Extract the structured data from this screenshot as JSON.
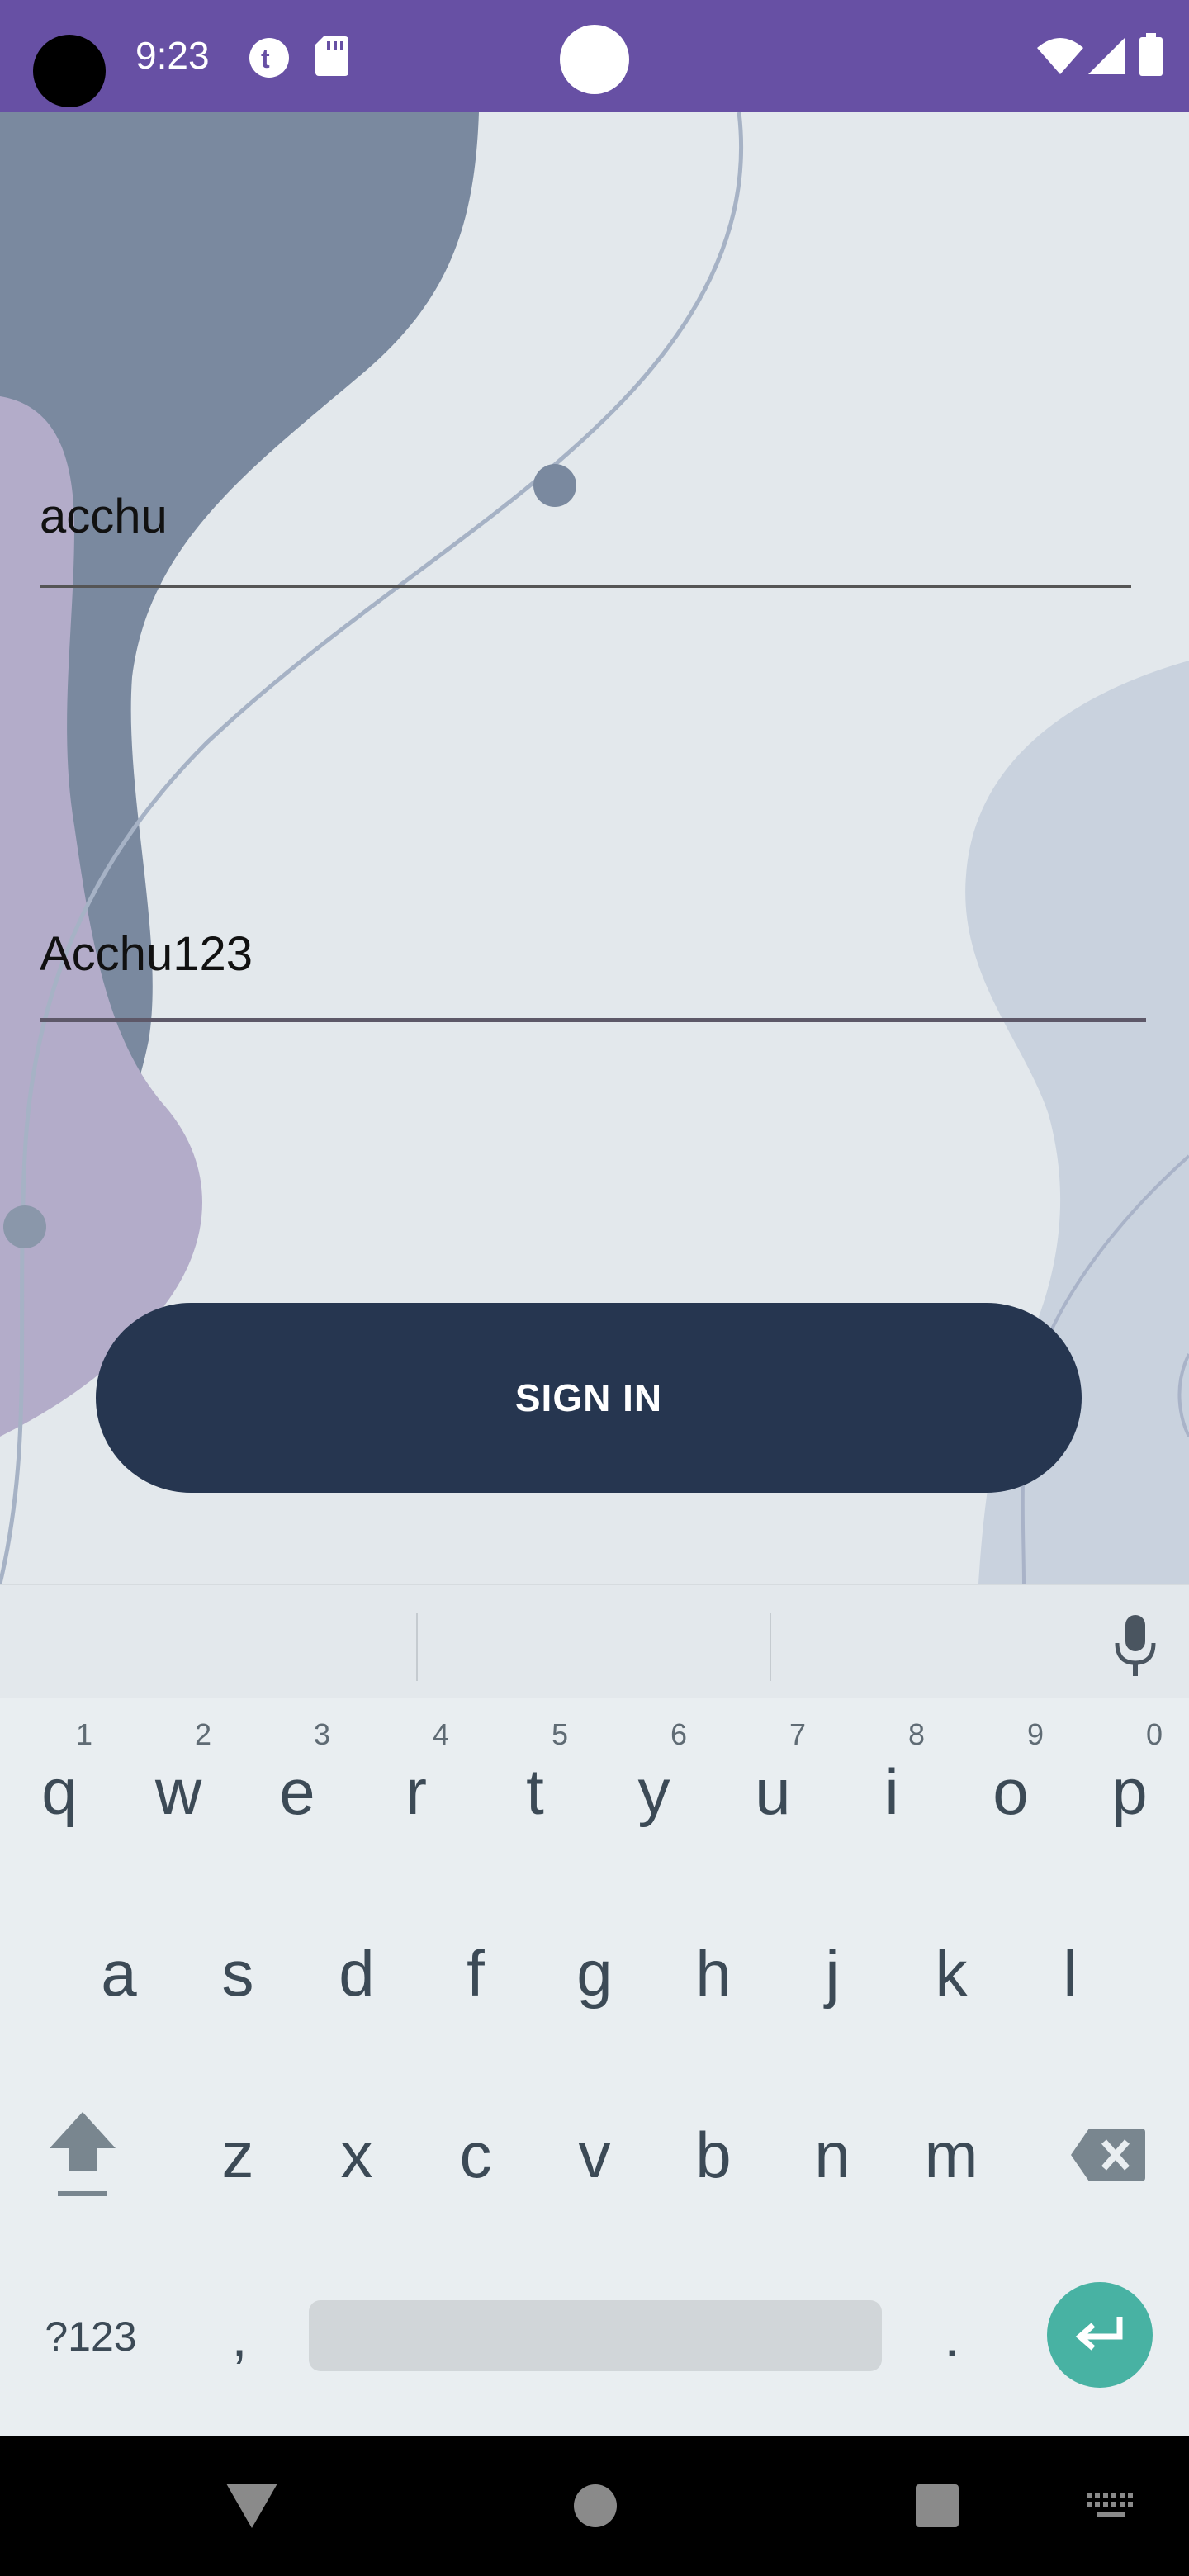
{
  "status_bar": {
    "time": "9:23",
    "icons": [
      "camera-cutout",
      "t-app-icon",
      "sd-card-icon",
      "wifi-icon",
      "signal-icon",
      "battery-icon"
    ],
    "background_color": "#6750a4"
  },
  "form": {
    "username_value": "acchu",
    "password_value": "Acchu123",
    "sign_in_label": "SIGN IN"
  },
  "keyboard": {
    "row1": [
      {
        "key": "q",
        "hint": "1"
      },
      {
        "key": "w",
        "hint": "2"
      },
      {
        "key": "e",
        "hint": "3"
      },
      {
        "key": "r",
        "hint": "4"
      },
      {
        "key": "t",
        "hint": "5"
      },
      {
        "key": "y",
        "hint": "6"
      },
      {
        "key": "u",
        "hint": "7"
      },
      {
        "key": "i",
        "hint": "8"
      },
      {
        "key": "o",
        "hint": "9"
      },
      {
        "key": "p",
        "hint": "0"
      }
    ],
    "row2": [
      "a",
      "s",
      "d",
      "f",
      "g",
      "h",
      "j",
      "k",
      "l"
    ],
    "row3": [
      "z",
      "x",
      "c",
      "v",
      "b",
      "n",
      "m"
    ],
    "symbols_label": "?123",
    "comma_label": ",",
    "period_label": ".",
    "enter_color": "#48b2a3"
  },
  "nav_bar": {
    "buttons": [
      "back-icon",
      "home-icon",
      "recents-icon",
      "keyboard-icon"
    ]
  },
  "colors": {
    "button": "#263650",
    "background": "#e3e8ec",
    "accent": "#6750a4"
  }
}
